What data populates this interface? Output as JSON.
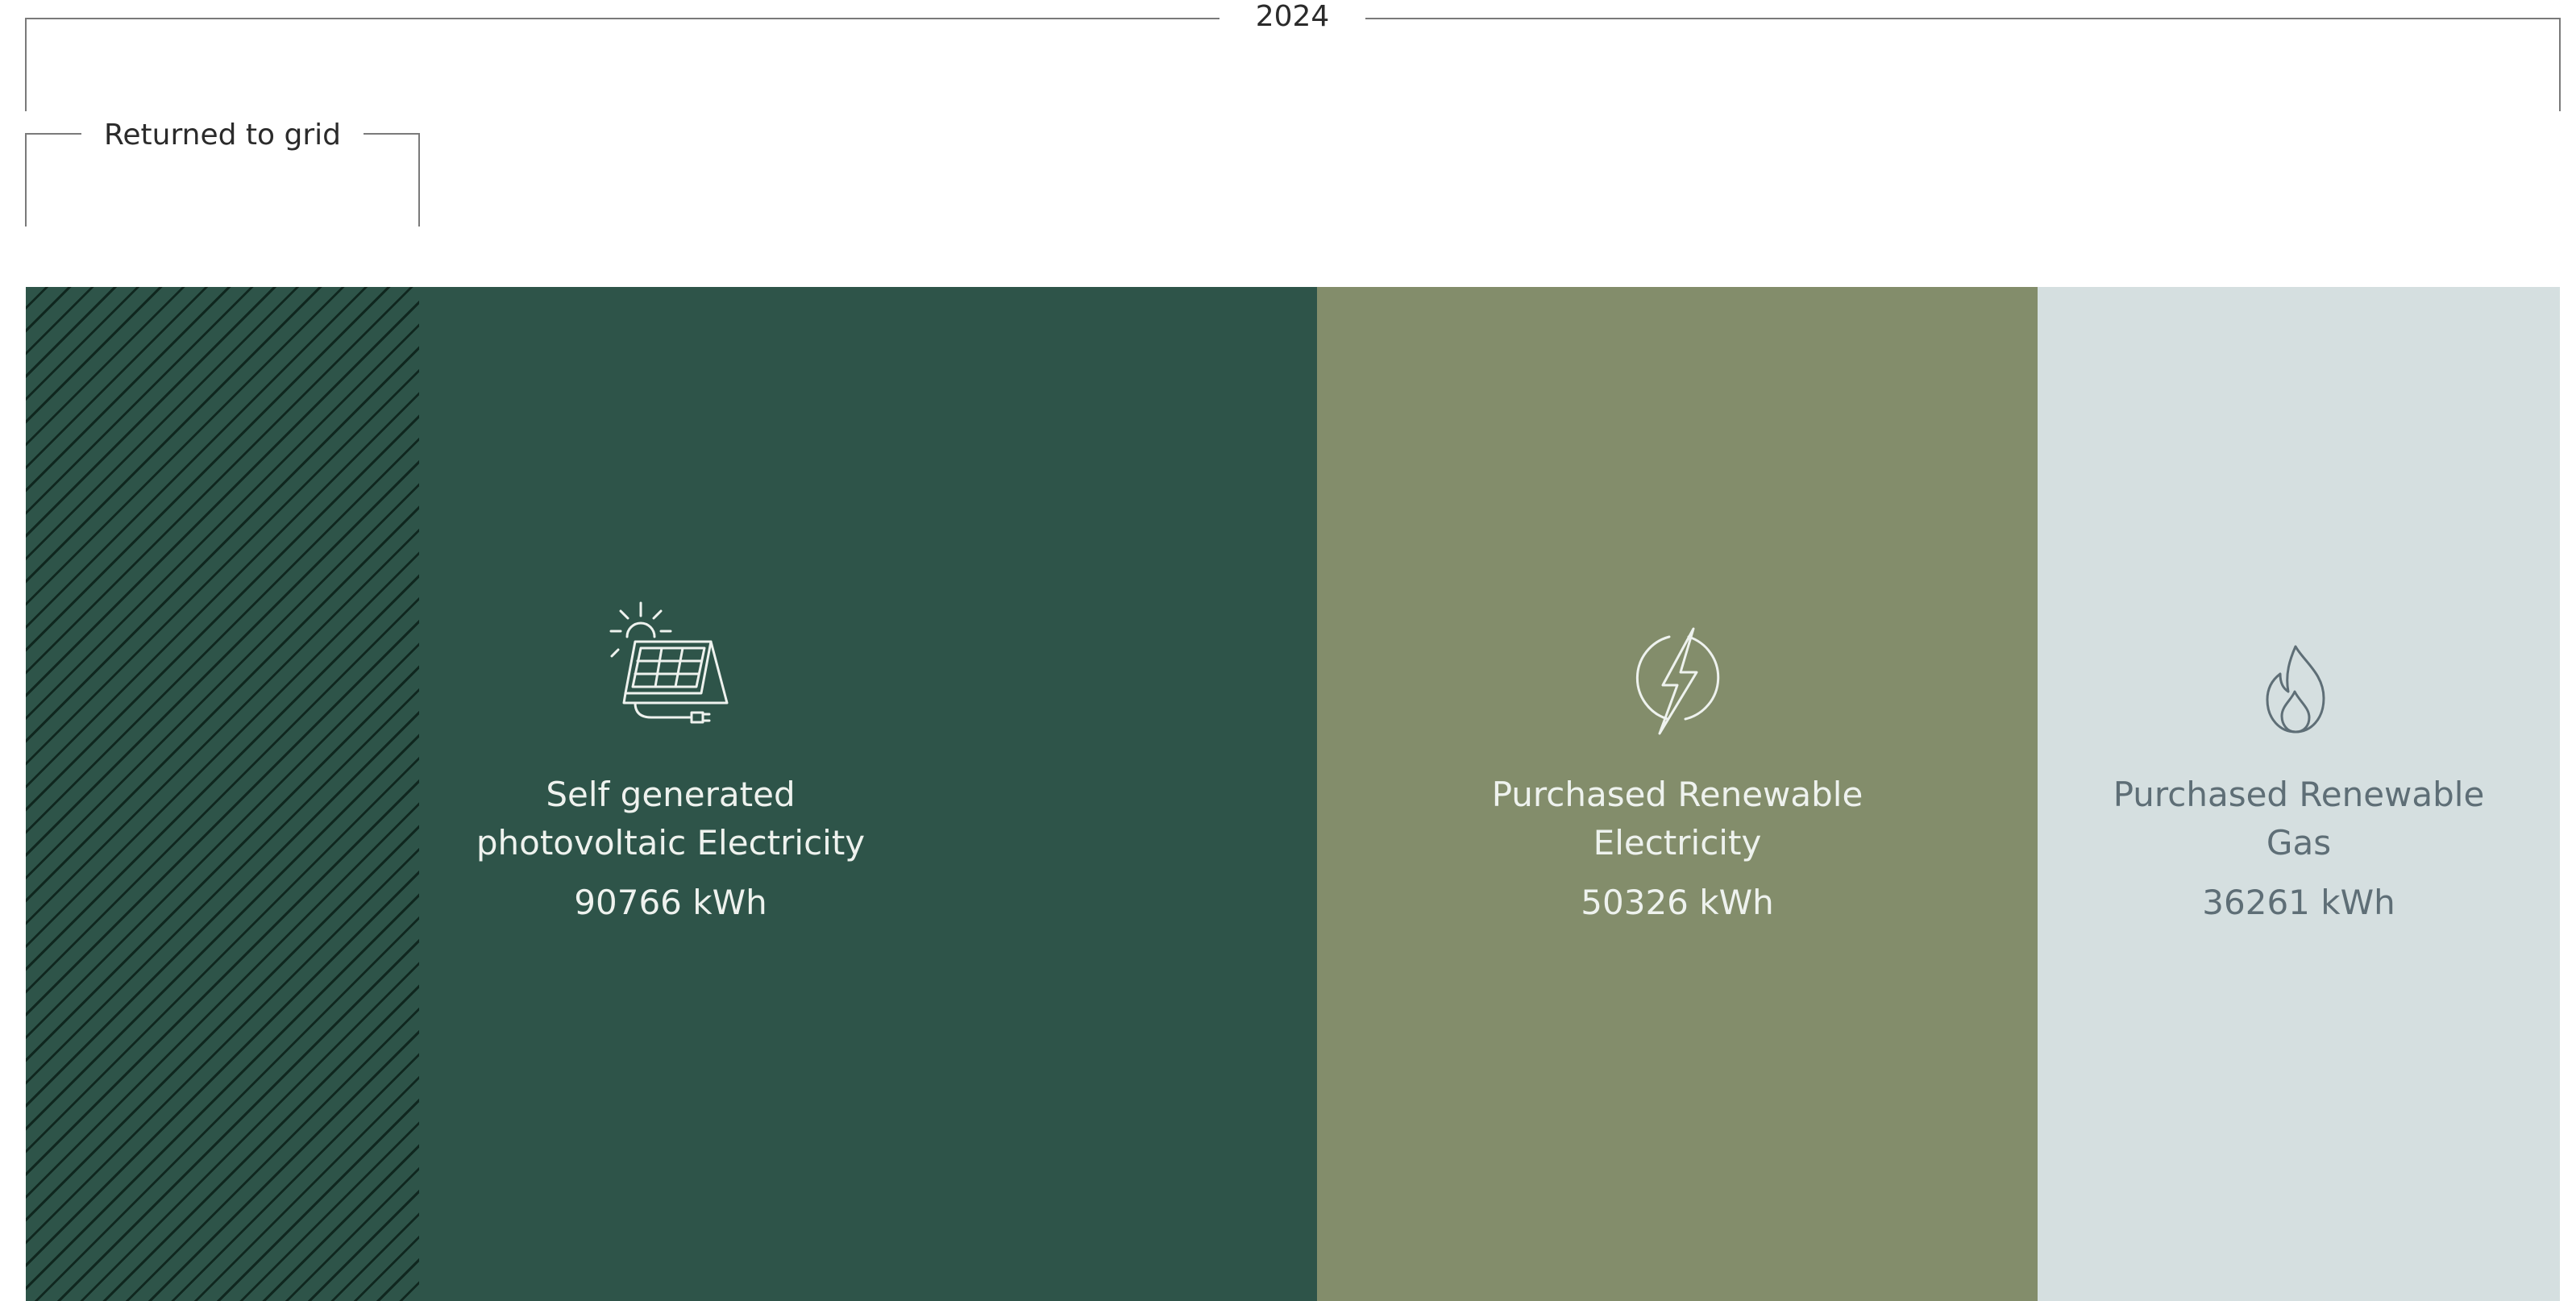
{
  "chart_data": {
    "type": "bar",
    "orientation": "stacked-horizontal",
    "title": "",
    "group_label": "2024",
    "unit": "kWh",
    "categories": [
      "Self generated photovoltaic Electricity",
      "Purchased Renewable Electricity",
      "Purchased Renewable Gas"
    ],
    "values": [
      90766,
      50326,
      36261
    ],
    "value_labels": [
      "90766 kWh",
      "50326 kWh",
      "36261 kWh"
    ],
    "label_lines": [
      [
        "Self generated",
        "photovoltaic Electricity"
      ],
      [
        "Purchased Renewable",
        "Electricity"
      ],
      [
        "Purchased Renewable",
        "Gas"
      ]
    ],
    "colors": [
      "#2e5449",
      "#838d6b",
      "#d5dfe0"
    ],
    "icons": [
      "solar-panel-icon",
      "lightning-bolt-icon",
      "flame-icon"
    ],
    "subsegment": {
      "label": "Returned to grid",
      "of_category": "Self generated photovoltaic Electricity",
      "fraction_of_total": 0.1556,
      "pattern": "diagonal-hatch"
    },
    "grid": false,
    "legend": "none"
  }
}
